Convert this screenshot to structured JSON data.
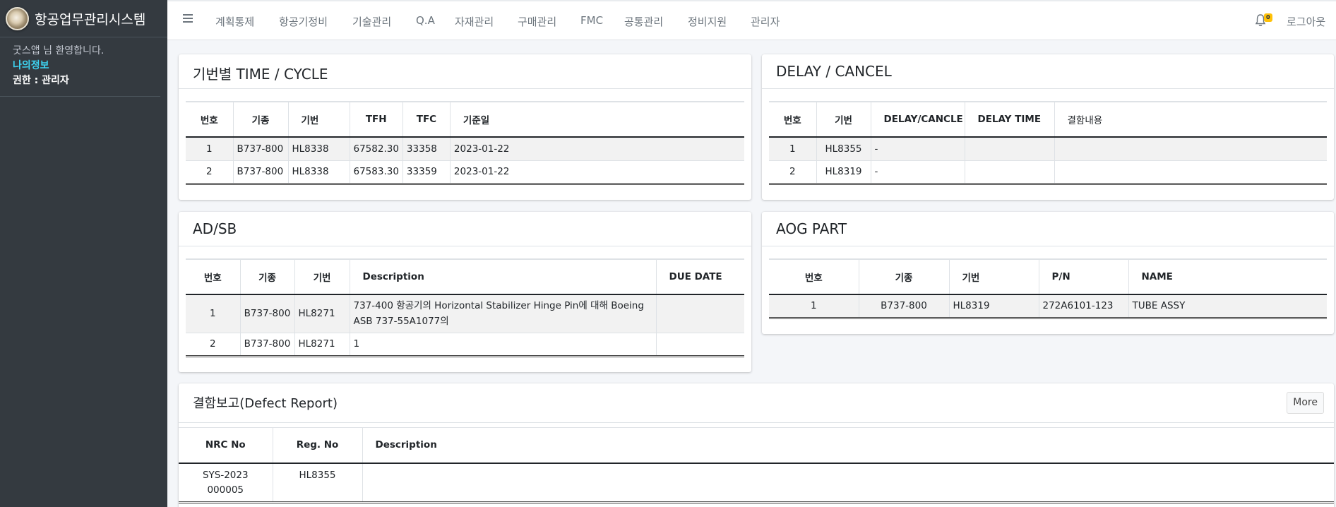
{
  "app": {
    "title": "항공업무관리시스템"
  },
  "user": {
    "welcome": "굿스앱 님 환영합니다.",
    "myinfo": "나의정보",
    "role": "권한 : 관리자"
  },
  "nav": [
    {
      "label": "계획통제"
    },
    {
      "label": "항공기정비"
    },
    {
      "label": "기술관리"
    },
    {
      "label": "Q.A"
    },
    {
      "label": "자재관리"
    },
    {
      "label": "구매관리"
    },
    {
      "label": "FMC"
    },
    {
      "label": "공통관리"
    },
    {
      "label": "정비지원"
    },
    {
      "label": "관리자"
    }
  ],
  "notifications": {
    "count": "0"
  },
  "logout": "로그아웃",
  "time_cycle": {
    "title": "기번별 TIME / CYCLE",
    "headers": [
      "번호",
      "기종",
      "기번",
      "TFH",
      "TFC",
      "기준일"
    ],
    "rows": [
      [
        "1",
        "B737-800",
        "HL8338",
        "67582.30",
        "33358",
        "2023-01-22"
      ],
      [
        "2",
        "B737-800",
        "HL8338",
        "67583.30",
        "33359",
        "2023-01-22"
      ]
    ]
  },
  "delay_cancel": {
    "title": "DELAY / CANCEL",
    "headers": [
      "번호",
      "기번",
      "DELAY/CANCLE",
      "DELAY TIME",
      "결함내용"
    ],
    "rows": [
      [
        "1",
        "HL8355",
        "-",
        "",
        ""
      ],
      [
        "2",
        "HL8319",
        "-",
        "",
        ""
      ]
    ]
  },
  "adsb": {
    "title": "AD/SB",
    "headers": [
      "번호",
      "기종",
      "기번",
      "Description",
      "DUE DATE"
    ],
    "rows": [
      [
        "1",
        "B737-800",
        "HL8271",
        "737-400 항공기의 Horizontal Stabilizer Hinge Pin에 대해 Boeing ASB 737-55A1077의",
        ""
      ],
      [
        "2",
        "B737-800",
        "HL8271",
        "1",
        ""
      ]
    ]
  },
  "aog_part": {
    "title": "AOG PART",
    "headers": [
      "번호",
      "기종",
      "기번",
      "P/N",
      "NAME"
    ],
    "rows": [
      [
        "1",
        "B737-800",
        "HL8319",
        "272A6101-123",
        "TUBE ASSY"
      ]
    ]
  },
  "defect_report": {
    "title": "결함보고(Defect Report)",
    "more": "More",
    "headers": [
      "NRC No",
      "Reg. No",
      "Description"
    ],
    "rows": [
      [
        "SYS-2023000005",
        "HL8355",
        ""
      ]
    ]
  }
}
